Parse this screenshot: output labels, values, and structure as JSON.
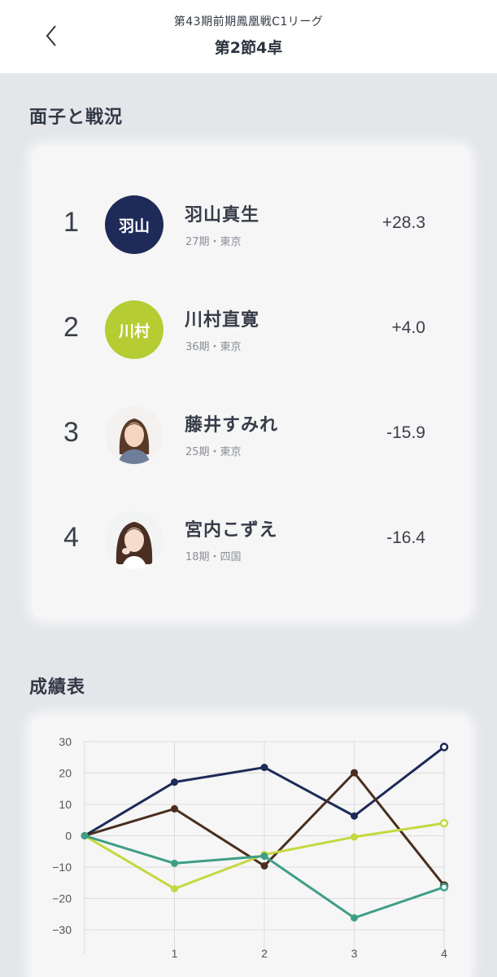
{
  "header": {
    "subtitle": "第43期前期鳳凰戦C1リーグ",
    "title": "第2節4卓"
  },
  "sections": {
    "standings": "面子と戦況",
    "results": "成績表"
  },
  "players": [
    {
      "rank": "1",
      "name": "羽山真生",
      "info": "27期・東京",
      "score": "+28.3",
      "avatar_text": "羽山",
      "avatar_color": "#1e2a57",
      "color": "#1e2a57"
    },
    {
      "rank": "2",
      "name": "川村直寛",
      "info": "36期・東京",
      "score": "+4.0",
      "avatar_text": "川村",
      "avatar_color": "#b5cc33",
      "color": "#c5d840"
    },
    {
      "rank": "3",
      "name": "藤井すみれ",
      "info": "25期・東京",
      "score": "-15.9",
      "avatar_text": "",
      "avatar_color": "#ffffff",
      "color": "#4a2e1e"
    },
    {
      "rank": "4",
      "name": "宮内こずえ",
      "info": "18期・四国",
      "score": "-16.4",
      "avatar_text": "",
      "avatar_color": "#ffffff",
      "color": "#3f9e86"
    }
  ],
  "chart_data": {
    "type": "line",
    "x": [
      0,
      1,
      2,
      3,
      4
    ],
    "xticks": [
      "1",
      "2",
      "3",
      "4"
    ],
    "ylim": [
      -30,
      30
    ],
    "yticks": [
      "30",
      "20",
      "10",
      "0",
      "−10",
      "−20",
      "−30"
    ],
    "grid": true,
    "series": [
      {
        "color": "#1e2a57",
        "values": [
          0,
          17.1,
          21.8,
          6.3,
          28.3
        ]
      },
      {
        "color": "#4a2e1e",
        "values": [
          0,
          8.6,
          -9.6,
          20.1,
          -15.9
        ]
      },
      {
        "color": "#c5d840",
        "values": [
          0,
          -16.9,
          -6.0,
          -0.4,
          4.0
        ]
      },
      {
        "color": "#3f9e86",
        "values": [
          0,
          -8.8,
          -6.5,
          -26.2,
          -16.4
        ]
      }
    ]
  }
}
